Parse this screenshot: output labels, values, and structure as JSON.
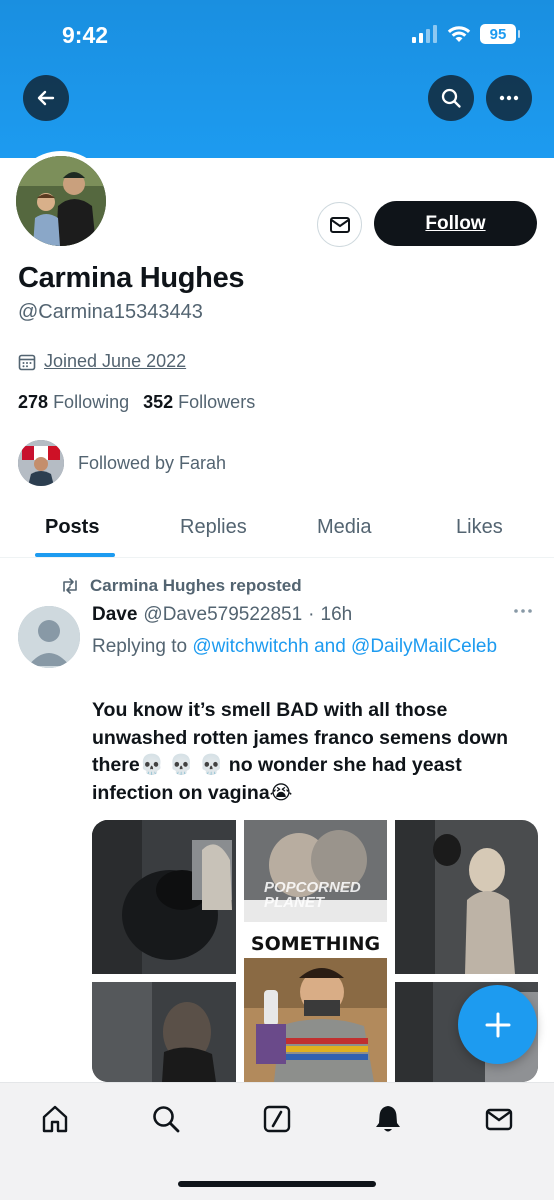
{
  "status_bar": {
    "time": "9:42",
    "battery": "95"
  },
  "profile": {
    "name": "Carmina Hughes",
    "handle": "@Carmina15343443",
    "joined": "Joined June 2022",
    "following_count": "278",
    "following_label": "Following",
    "followers_count": "352",
    "followers_label": "Followers",
    "followed_by": "Followed by Farah",
    "follow_label": "Follow"
  },
  "tabs": [
    {
      "label": "Posts",
      "active": true
    },
    {
      "label": "Replies",
      "active": false
    },
    {
      "label": "Media",
      "active": false
    },
    {
      "label": "Likes",
      "active": false
    }
  ],
  "post": {
    "repost_label": "Carmina Hughes reposted",
    "author": "Dave",
    "author_handle": "@Dave579522851",
    "separator": "·",
    "time": "16h",
    "replying_prefix": "Replying to",
    "reply_handle_1": "@witchwitchh",
    "reply_and": "and",
    "reply_handle_2": "@DailyMailCeleb",
    "text": "You know it’s smell BAD with all those unwashed rotten james franco semens down there💀 💀 💀 no wonder she had yeast infection on vagina😭",
    "media_labels": {
      "meme_caption": "SOMETHING",
      "watermark_line1": "POPCORNED",
      "watermark_line2": "PLANET"
    }
  },
  "icons": {
    "back": "back-arrow-icon",
    "search": "search-icon",
    "more": "more-icon",
    "mail": "mail-icon",
    "calendar": "calendar-icon",
    "repost": "repost-icon",
    "compose": "plus-icon",
    "nav": [
      "home-icon",
      "search-icon",
      "grok-icon",
      "bell-icon",
      "mail-icon"
    ]
  },
  "colors": {
    "accent": "#1d9bf0",
    "text": "#0f1419",
    "muted": "#536471"
  }
}
